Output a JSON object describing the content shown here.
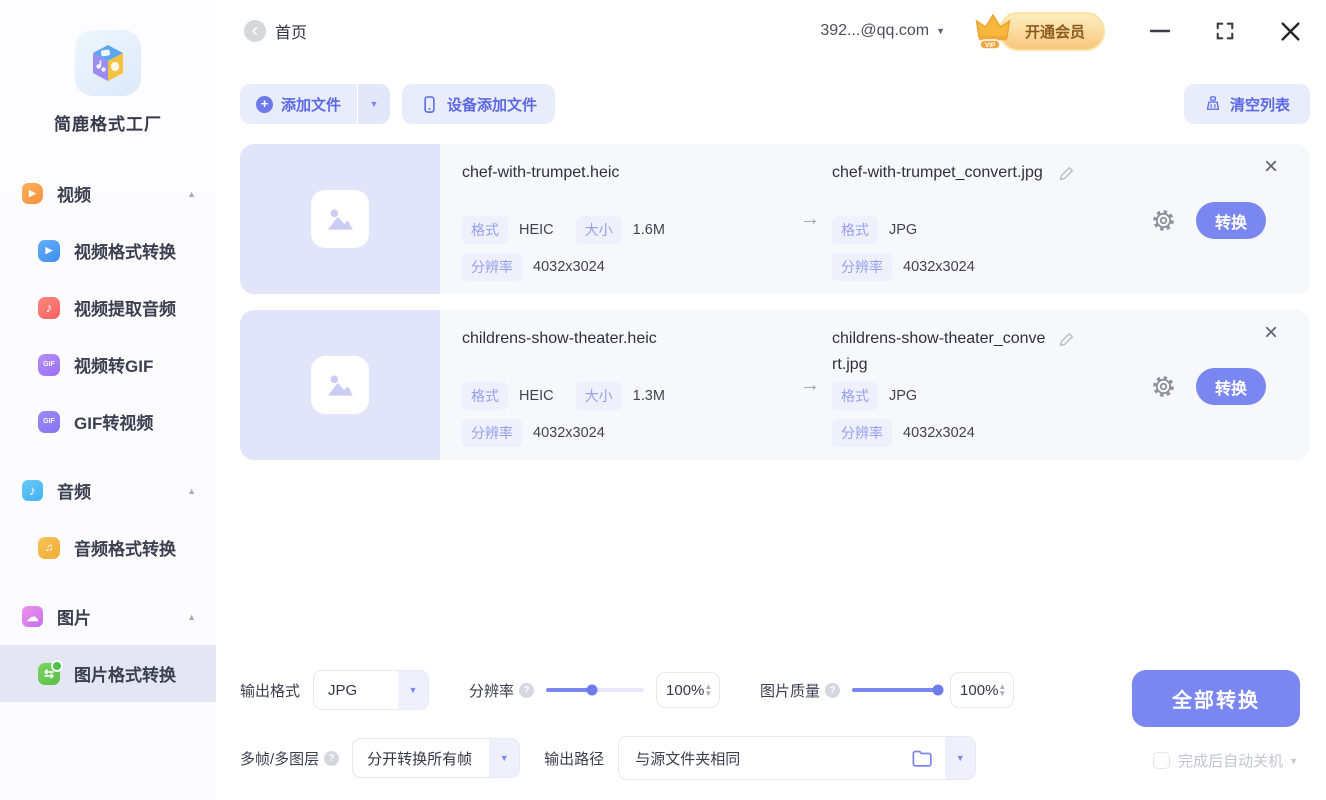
{
  "colors": {
    "primary": "#7B87F0",
    "toolbar_button_bg": "#E9ECFB",
    "toolbar_button_text": "#5C69E6",
    "tag_bg": "#EEF0FB",
    "tag_text": "#97A0EF",
    "thumbnail_bg": "#E2E4F9",
    "card_bg": "#F7F8FC",
    "active_item_bg": "#E4E6F3",
    "vip_text": "#8A5B1F",
    "text_dark": "#2C313D"
  },
  "sidebar": {
    "app_title": "简鹿格式工厂",
    "items": [
      {
        "label": "视频",
        "icon": "video-icon",
        "section": true,
        "expanded": true
      },
      {
        "label": "视频格式转换",
        "icon": "video-convert-icon"
      },
      {
        "label": "视频提取音频",
        "icon": "video-extract-audio-icon"
      },
      {
        "label": "视频转GIF",
        "icon": "video-to-gif-icon"
      },
      {
        "label": "GIF转视频",
        "icon": "gif-to-video-icon"
      },
      {
        "label": "音频",
        "icon": "audio-icon",
        "section": true,
        "expanded": true
      },
      {
        "label": "音频格式转换",
        "icon": "audio-convert-icon"
      },
      {
        "label": "图片",
        "icon": "image-icon",
        "section": true,
        "expanded": true
      },
      {
        "label": "图片格式转换",
        "icon": "image-convert-icon",
        "active": true
      }
    ]
  },
  "topbar": {
    "home": "首页",
    "account": "392...@qq.com",
    "vip_badge": "VIP",
    "vip_label": "开通会员"
  },
  "toolbar": {
    "add_file": "添加文件",
    "device_add_file": "设备添加文件",
    "clear_list": "清空列表"
  },
  "labels": {
    "format": "格式",
    "size": "大小",
    "resolution": "分辨率",
    "convert": "转换"
  },
  "files": [
    {
      "source_name": "chef-with-trumpet.heic",
      "source_format": "HEIC",
      "source_size": "1.6M",
      "source_resolution": "4032x3024",
      "output_name": "chef-with-trumpet_convert.jpg",
      "output_format": "JPG",
      "output_resolution": "4032x3024"
    },
    {
      "source_name": "childrens-show-theater.heic",
      "source_format": "HEIC",
      "source_size": "1.3M",
      "source_resolution": "4032x3024",
      "output_name": "childrens-show-theater_convert.jpg",
      "output_format": "JPG",
      "output_resolution": "4032x3024"
    }
  ],
  "settings": {
    "output_format_label": "输出格式",
    "output_format_value": "JPG",
    "resolution_label": "分辨率",
    "resolution_value": "100%",
    "resolution_slider_percent": 47,
    "quality_label": "图片质量",
    "quality_value": "100%",
    "quality_slider_percent": 100,
    "multiframe_label": "多帧/多图层",
    "multiframe_value": "分开转换所有帧",
    "output_path_label": "输出路径",
    "output_path_value": "与源文件夹相同",
    "convert_all": "全部转换",
    "auto_shutdown": "完成后自动关机"
  },
  "icons": {
    "back": "back-arrow-icon",
    "account_caret": "chevron-down-icon",
    "vip": "crown-icon",
    "minimize": "minimize-icon",
    "maximize": "maximize-icon",
    "close": "close-icon",
    "add": "plus-circle-icon",
    "device": "phone-icon",
    "clear": "broom-icon",
    "thumbnail": "image-placeholder-icon",
    "edit": "pencil-icon",
    "row_settings": "gear-icon",
    "row_remove": "close-icon",
    "transfer": "arrow-right-icon",
    "help": "question-circle-icon",
    "folder": "folder-icon"
  }
}
